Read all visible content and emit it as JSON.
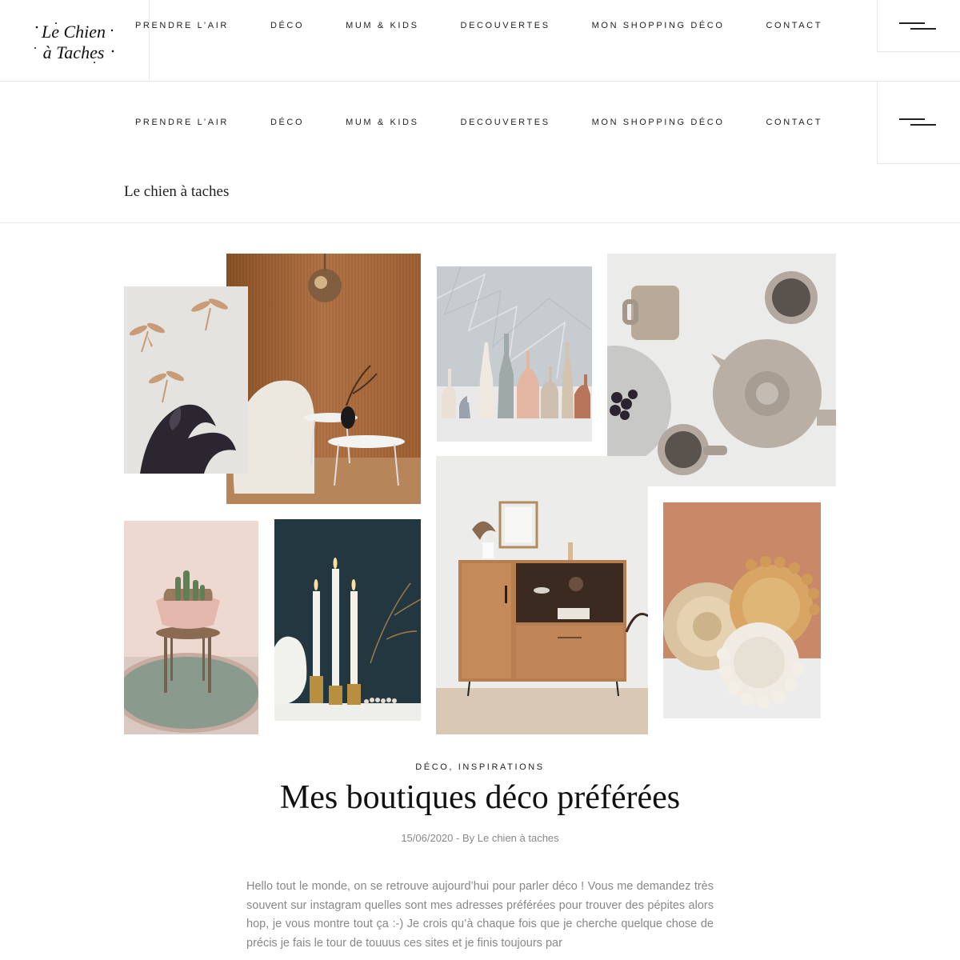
{
  "brand": {
    "logo_line1": "Le Chien",
    "logo_line2": "à Taches"
  },
  "nav": {
    "items": [
      {
        "label": "PRENDRE L’AIR"
      },
      {
        "label": "DÉCO"
      },
      {
        "label": "MUM & KIDS"
      },
      {
        "label": "DECOUVERTES"
      },
      {
        "label": "MON SHOPPING DÉCO"
      },
      {
        "label": "CONTACT"
      }
    ]
  },
  "site_title": "Le chien à taches",
  "post": {
    "category_1": "DÉCO",
    "category_sep": ", ",
    "category_2": "INSPIRATIONS",
    "title": "Mes boutiques déco préférées",
    "date": "15/06/2020",
    "by_label": " - By ",
    "author": "Le chien à taches",
    "excerpt": "Hello tout le monde, on se retrouve aujourd’hui pour parler déco ! Vous me demandez très souvent sur instagram quelles sont mes adresses préférées pour trouver des pépites alors hop, je vous montre tout ça :-) Je crois qu’à chaque fois que je cherche quelque chose de précis je fais le tour de touuus ces sites et je finis toujours par"
  },
  "colors": {
    "text": "#222222",
    "muted": "#888888",
    "border": "#e6e6e6"
  }
}
